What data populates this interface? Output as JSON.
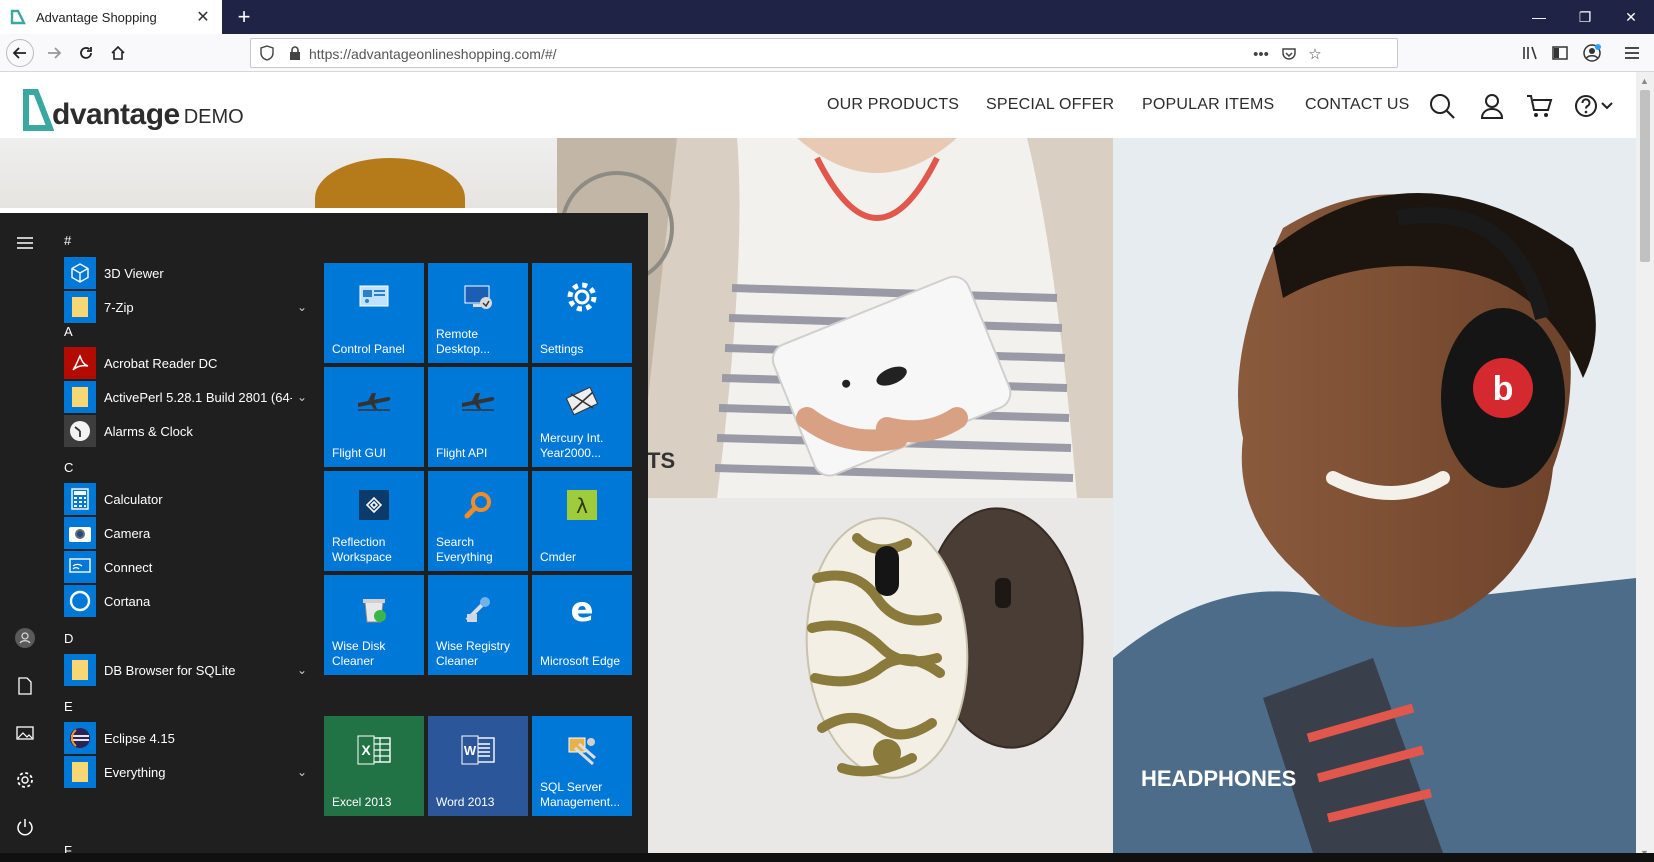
{
  "browser": {
    "tab_title": "Advantage Shopping",
    "new_tab_label": "+",
    "url": "https://advantageonlineshopping.com/#/",
    "url_more": "•••"
  },
  "site": {
    "logo_main": "dvantage",
    "logo_suffix": "DEMO",
    "menu": [
      "OUR PRODUCTS",
      "SPECIAL OFFER",
      "POPULAR ITEMS",
      "CONTACT US"
    ],
    "hero_partial_label": "TS",
    "headphones_label": "HEADPHONES"
  },
  "start_menu": {
    "sections": [
      {
        "letter": "#",
        "apps": [
          {
            "label": "3D Viewer",
            "icon": "cube-icon",
            "expandable": false
          },
          {
            "label": "7-Zip",
            "icon": "folder-icon",
            "expandable": true
          }
        ]
      },
      {
        "letter": "A",
        "apps": [
          {
            "label": "Acrobat Reader DC",
            "icon": "acrobat-icon",
            "expandable": false
          },
          {
            "label": "ActivePerl 5.28.1 Build 2801 (64-...",
            "icon": "folder-icon",
            "expandable": true
          },
          {
            "label": "Alarms & Clock",
            "icon": "clock-icon",
            "expandable": false
          }
        ]
      },
      {
        "letter": "C",
        "apps": [
          {
            "label": "Calculator",
            "icon": "calculator-icon",
            "expandable": false
          },
          {
            "label": "Camera",
            "icon": "camera-icon",
            "expandable": false
          },
          {
            "label": "Connect",
            "icon": "connect-icon",
            "expandable": false
          },
          {
            "label": "Cortana",
            "icon": "cortana-icon",
            "expandable": false
          }
        ]
      },
      {
        "letter": "D",
        "apps": [
          {
            "label": "DB Browser for SQLite",
            "icon": "folder-icon",
            "expandable": true
          }
        ]
      },
      {
        "letter": "E",
        "apps": [
          {
            "label": "Eclipse 4.15",
            "icon": "eclipse-icon",
            "expandable": false
          },
          {
            "label": "Everything",
            "icon": "folder-icon",
            "expandable": true
          }
        ]
      },
      {
        "letter": "F",
        "apps": []
      }
    ],
    "tiles": [
      {
        "label": "Control Panel",
        "icon": "control-panel-icon",
        "color": "#0078d7"
      },
      {
        "label": "Remote Desktop...",
        "icon": "remote-desktop-icon",
        "color": "#0078d7"
      },
      {
        "label": "Settings",
        "icon": "gear-icon",
        "color": "#0078d7"
      },
      {
        "label": "Flight GUI",
        "icon": "airplane-icon",
        "color": "#0078d7"
      },
      {
        "label": "Flight API",
        "icon": "airplane-icon",
        "color": "#0078d7"
      },
      {
        "label": "Mercury Int. Year2000...",
        "icon": "mercury-icon",
        "color": "#0078d7"
      },
      {
        "label": "Reflection Workspace",
        "icon": "reflection-icon",
        "color": "#0078d7"
      },
      {
        "label": "Search Everything",
        "icon": "magnifier-icon",
        "color": "#0078d7"
      },
      {
        "label": "Cmder",
        "icon": "lambda-icon",
        "color": "#0078d7"
      },
      {
        "label": "Wise Disk Cleaner",
        "icon": "disk-cleaner-icon",
        "color": "#0078d7"
      },
      {
        "label": "Wise Registry Cleaner",
        "icon": "registry-cleaner-icon",
        "color": "#0078d7"
      },
      {
        "label": "Microsoft Edge",
        "icon": "edge-icon",
        "color": "#0078d7"
      },
      {
        "label": "Excel 2013",
        "icon": "excel-icon",
        "color": "#217346"
      },
      {
        "label": "Word 2013",
        "icon": "word-icon",
        "color": "#2b579a"
      },
      {
        "label": "SQL Server Management...",
        "icon": "sql-server-icon",
        "color": "#0078d7"
      }
    ]
  }
}
